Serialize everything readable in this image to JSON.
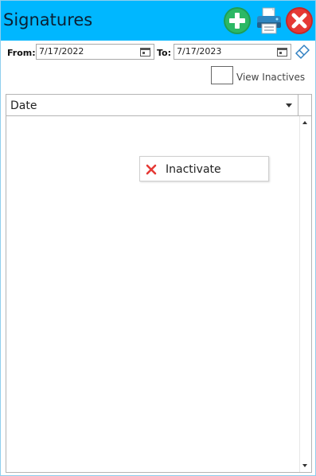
{
  "window": {
    "title": "Signatures"
  },
  "toolbar": {
    "add_icon": "add-circle-icon",
    "print_icon": "printer-icon",
    "close_icon": "close-circle-icon"
  },
  "filters": {
    "from_label": "From:",
    "from_value": "7/17/2022",
    "to_label": "To:",
    "to_value": "7/17/2023",
    "clear_icon": "eraser-icon",
    "view_inactives_label": "View Inactives",
    "view_inactives_checked": false
  },
  "grid": {
    "columns": [
      {
        "label": "Date"
      }
    ],
    "rows": []
  },
  "context_menu": {
    "items": [
      {
        "label": "Inactivate",
        "icon": "x-icon"
      }
    ]
  },
  "colors": {
    "titlebar": "#00b7ff",
    "add": "#22a85a",
    "close": "#e53935",
    "printer": "#2e86c1"
  }
}
